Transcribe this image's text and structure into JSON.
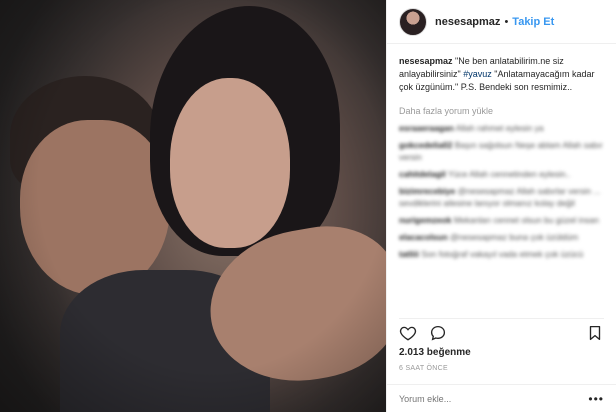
{
  "post": {
    "username": "nesesapmaz",
    "follow_label": "Takip Et",
    "separator": "•",
    "caption_text": "\"Ne ben anlatabilirim.ne siz anlayabilirsiniz\"",
    "hashtag": "#yavuz",
    "caption_rest": "\"Anlatamayacağım kadar çok üzgünüm.\" P.S. Bendeki son resmimiz..",
    "load_more": "Daha fazla yorum yükle",
    "blurred_comments": [
      {
        "user": "esraaeraagan",
        "text": "Allah rahmet eylesin ya"
      },
      {
        "user": "gokcedelia02",
        "text": "Başın sağolsun Neşe ablam Allah sabır versin"
      },
      {
        "user": "cahitdelagil",
        "text": "Yüce Allah cennetinden eylesin.."
      },
      {
        "user": "bizimrecebiye",
        "text": "@nesesapmaz Allah sabırlar versin ... sevdiklerini ailesine lanıyor olmanız kolay değil"
      },
      {
        "user": "nurigemzeok",
        "text": "Mekanları cennet olsun bu güzel insan"
      },
      {
        "user": "elacacolsun",
        "text": "@nesesapmaz buna çok üzüldüm"
      },
      {
        "user": "tatliii",
        "text": "Son fotoğraf vakayıl vada etmek çok üzücü"
      }
    ],
    "likes": "2.013 beğenme",
    "time_ago": "6 SAAT ÖNCE",
    "comment_placeholder": "Yorum ekle...",
    "menu_label": "•••"
  },
  "icons": {
    "heart": "heart-icon",
    "comment": "comment-icon",
    "bookmark": "bookmark-icon"
  }
}
